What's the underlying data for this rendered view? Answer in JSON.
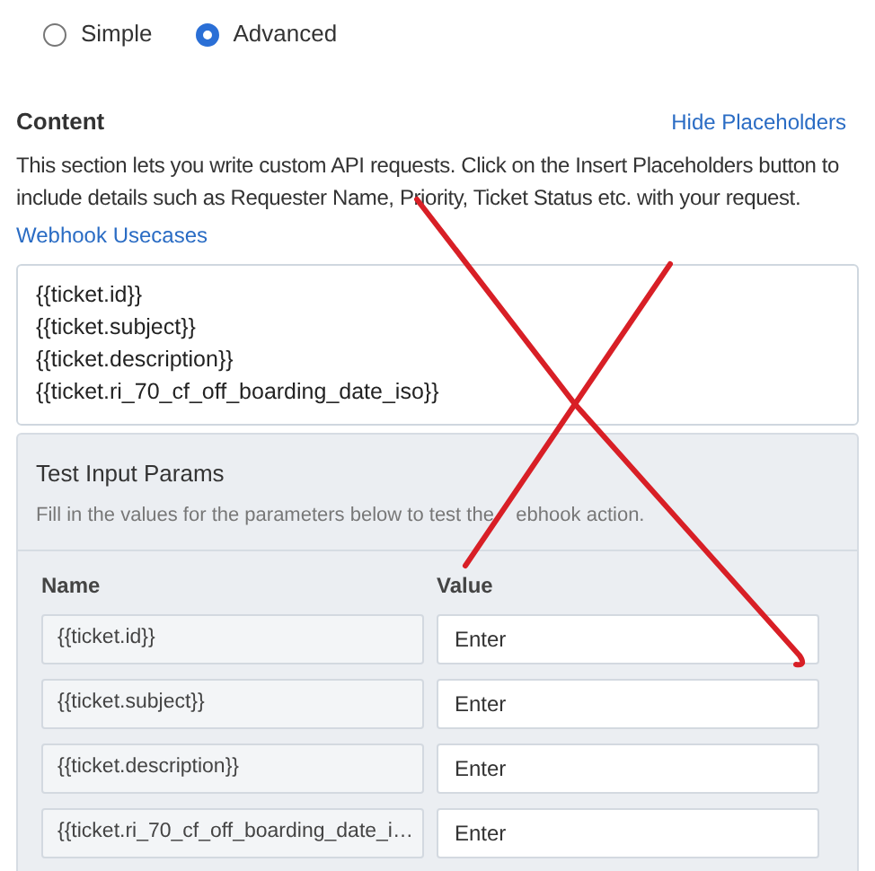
{
  "mode_options": [
    {
      "label": "Simple",
      "selected": false
    },
    {
      "label": "Advanced",
      "selected": true
    }
  ],
  "content": {
    "title": "Content",
    "toggle_link": "Hide Placeholders",
    "description": "This section lets you write custom API requests. Click on the Insert Placeholders button to include details such as Requester Name, Priority, Ticket Status etc. with your request.",
    "help_link": "Webhook Usecases",
    "body_lines": [
      "{{ticket.id}}",
      "{{ticket.subject}}",
      "{{ticket.description}}",
      "{{ticket.ri_70_cf_off_boarding_date_iso}}"
    ]
  },
  "test_params": {
    "title": "Test Input Params",
    "description": "Fill in the values for the parameters below to test the    ebhook action.",
    "columns": [
      "Name",
      "Value"
    ],
    "rows": [
      {
        "name": "{{ticket.id}}",
        "placeholder": "Enter"
      },
      {
        "name": "{{ticket.subject}}",
        "placeholder": "Enter"
      },
      {
        "name": "{{ticket.description}}",
        "placeholder": "Enter"
      },
      {
        "name": "{{ticket.ri_70_cf_off_boarding_date_i…",
        "placeholder": "Enter"
      }
    ]
  }
}
